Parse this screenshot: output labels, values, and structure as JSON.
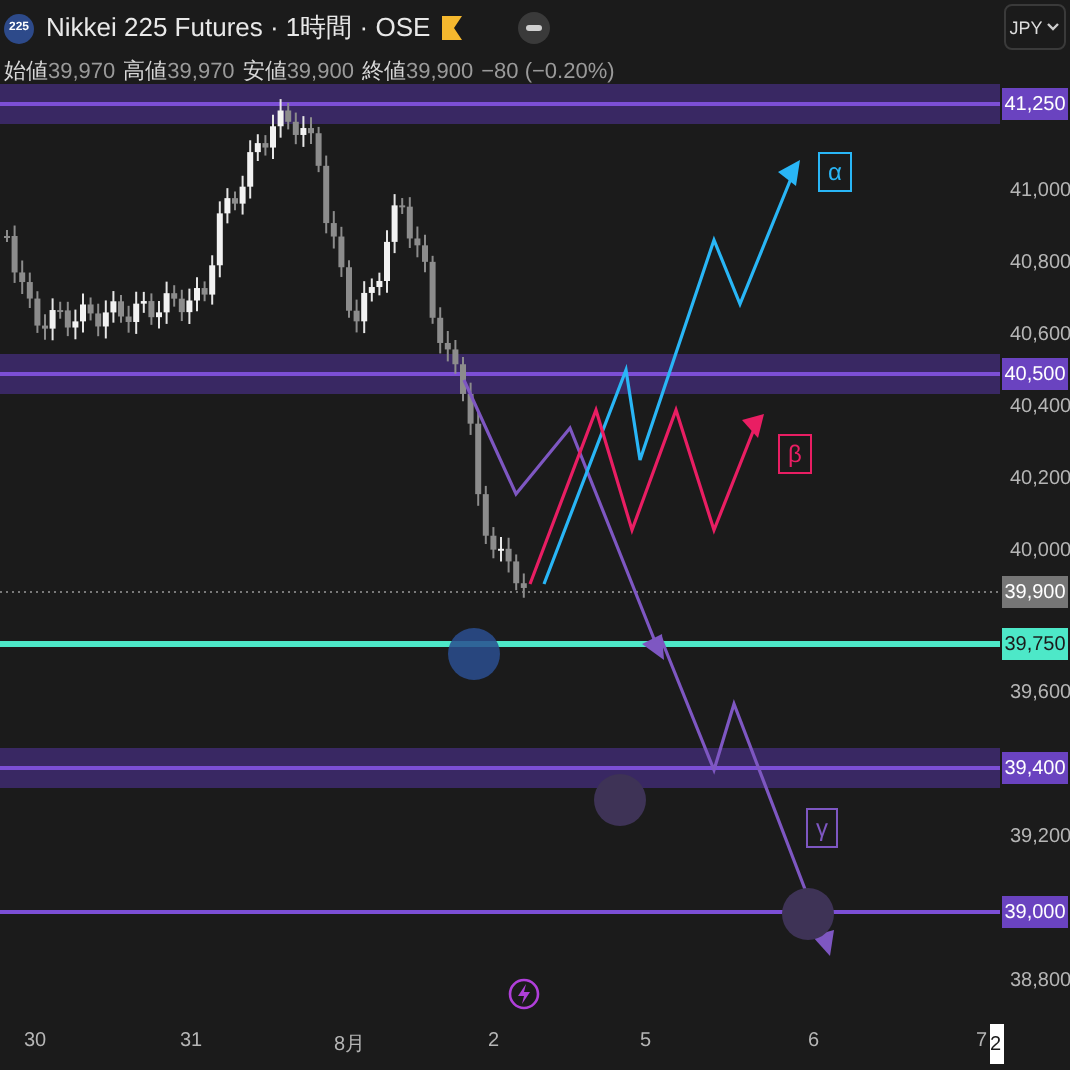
{
  "header": {
    "logo": "225",
    "title": "Nikkei 225 Futures · 1時間 · OSE",
    "ohlc": [
      {
        "label": "始値",
        "value": "39,970"
      },
      {
        "label": "高値",
        "value": "39,970"
      },
      {
        "label": "安値",
        "value": "39,900"
      },
      {
        "label": "終値",
        "value": "39,900"
      }
    ],
    "change": "−80 (−0.20%)"
  },
  "currency": {
    "label": "JPY"
  },
  "price_axis": {
    "ticks": [
      "41,000",
      "40,800",
      "40,600",
      "40,400",
      "40,200",
      "40,000",
      "39,600",
      "39,200",
      "38,800"
    ]
  },
  "levels": [
    {
      "label": "41,250",
      "kind": "zone"
    },
    {
      "label": "40,500",
      "kind": "zone"
    },
    {
      "label": "39,750",
      "kind": "highlight"
    },
    {
      "label": "39,400",
      "kind": "zone"
    },
    {
      "label": "39,000",
      "kind": "line"
    }
  ],
  "current_price": "39,900",
  "annotations": [
    {
      "label": "α",
      "color": "#29b6f6"
    },
    {
      "label": "β",
      "color": "#e91e63"
    },
    {
      "label": "γ",
      "color": "#7e57c2"
    }
  ],
  "time_axis": [
    "30",
    "31",
    "8月",
    "2",
    "5",
    "6",
    "7"
  ],
  "time_cursor": "2"
}
